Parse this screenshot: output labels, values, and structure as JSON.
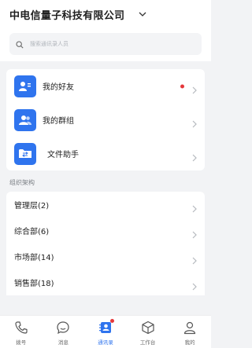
{
  "header": {
    "company_name": "中电信量子科技有限公司"
  },
  "search": {
    "placeholder": "搜索通讯录人员"
  },
  "quick_access": [
    {
      "label": "我的好友",
      "icon": "person-card-icon",
      "has_dot": true
    },
    {
      "label": "我的群组",
      "icon": "group-icon",
      "has_dot": false
    },
    {
      "label": "文件助手",
      "icon": "folder-icon",
      "has_dot": false
    }
  ],
  "org": {
    "section_title": "组织架构",
    "departments": [
      {
        "label": "管理层(2)"
      },
      {
        "label": "综合部(6)"
      },
      {
        "label": "市场部(14)"
      },
      {
        "label": "销售部(18)"
      }
    ]
  },
  "tabbar": {
    "tabs": [
      {
        "label": "拨号",
        "icon": "phone-icon",
        "active": false
      },
      {
        "label": "消息",
        "icon": "chat-icon",
        "active": false
      },
      {
        "label": "通讯录",
        "icon": "contacts-icon",
        "active": true,
        "has_dot": true
      },
      {
        "label": "工作台",
        "icon": "cube-icon",
        "active": false
      },
      {
        "label": "我的",
        "icon": "profile-icon",
        "active": false
      }
    ]
  },
  "colors": {
    "accent": "#2f74ee",
    "badge": "#e5383b"
  }
}
